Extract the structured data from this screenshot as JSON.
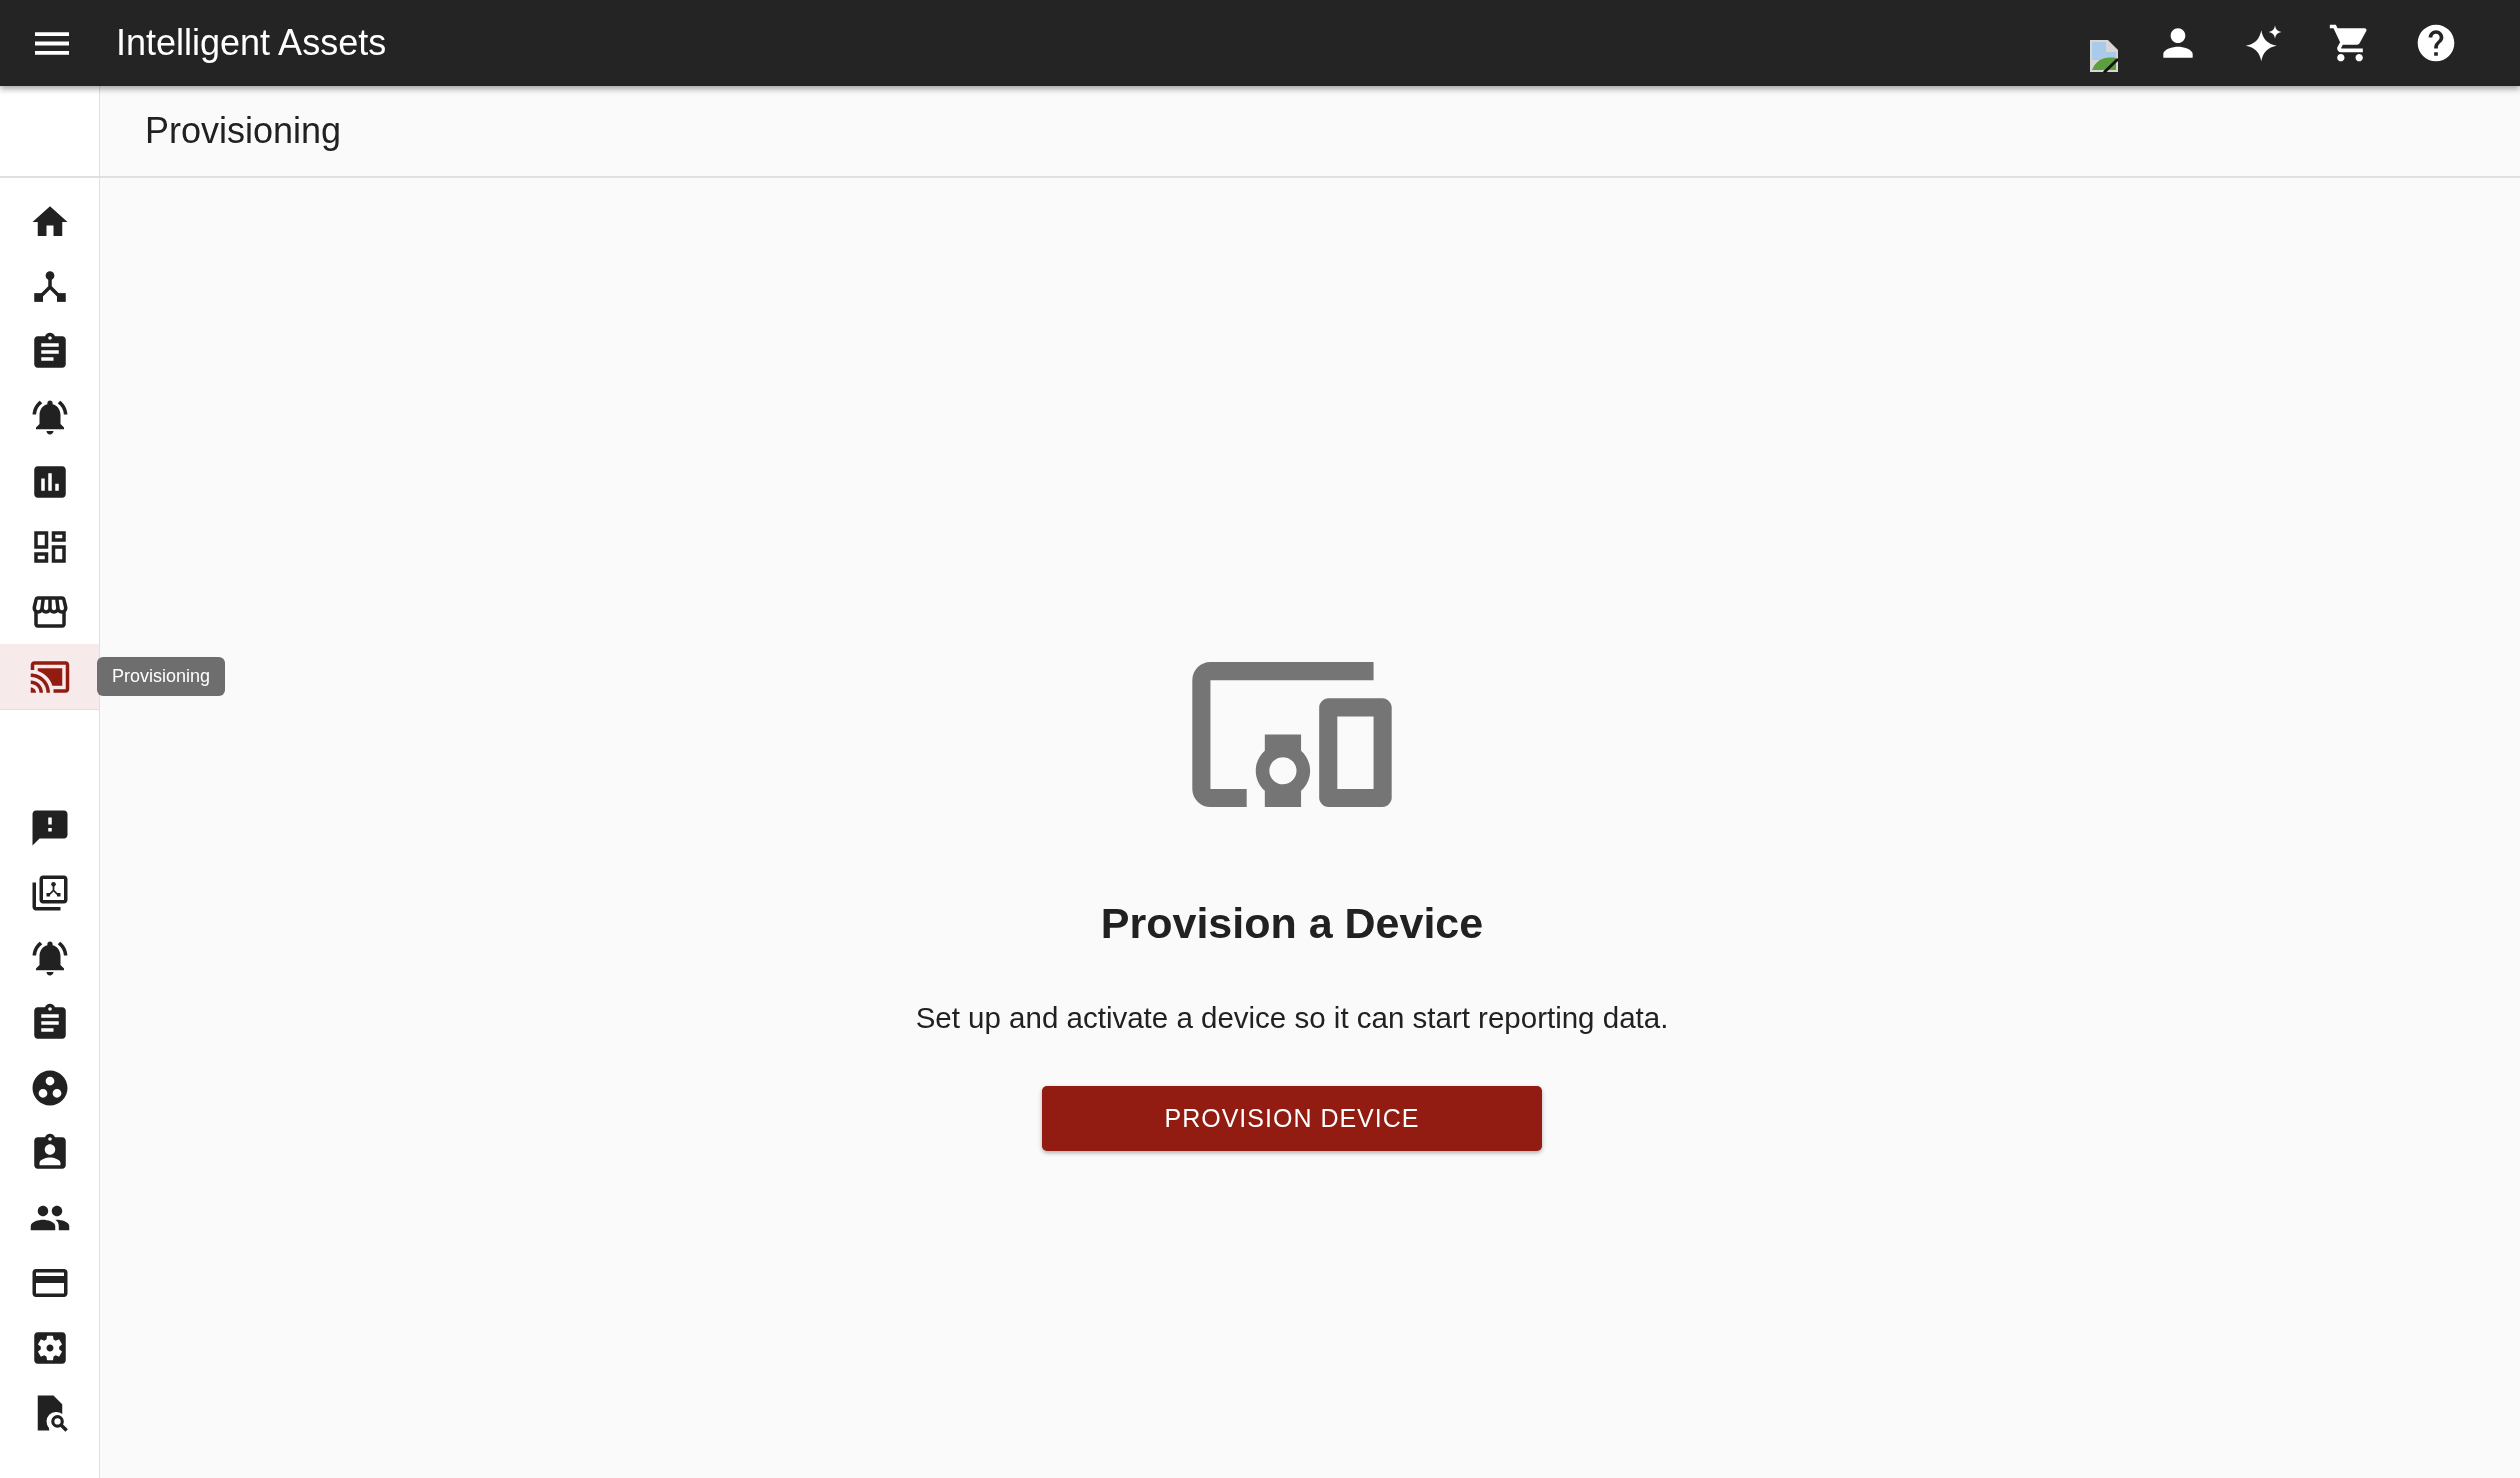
{
  "app_bar": {
    "title": "Intelligent Assets"
  },
  "page_header": {
    "title": "Provisioning"
  },
  "sidebar": {
    "groups": [
      {
        "items": [
          {
            "selected": false
          },
          {
            "selected": false
          },
          {
            "selected": false
          },
          {
            "selected": false
          },
          {
            "selected": false
          },
          {
            "selected": false
          },
          {
            "selected": false
          },
          {
            "selected": true,
            "tooltip": "Provisioning"
          }
        ]
      },
      {
        "items": [
          {
            "selected": false
          },
          {
            "selected": false
          },
          {
            "selected": false
          },
          {
            "selected": false
          },
          {
            "selected": false
          },
          {
            "selected": false
          },
          {
            "selected": false
          },
          {
            "selected": false
          },
          {
            "selected": false
          },
          {
            "selected": false
          }
        ]
      }
    ]
  },
  "empty_state": {
    "title": "Provision a Device",
    "description": "Set up and activate a device so it can start reporting data.",
    "button": "PROVISION DEVICE"
  }
}
